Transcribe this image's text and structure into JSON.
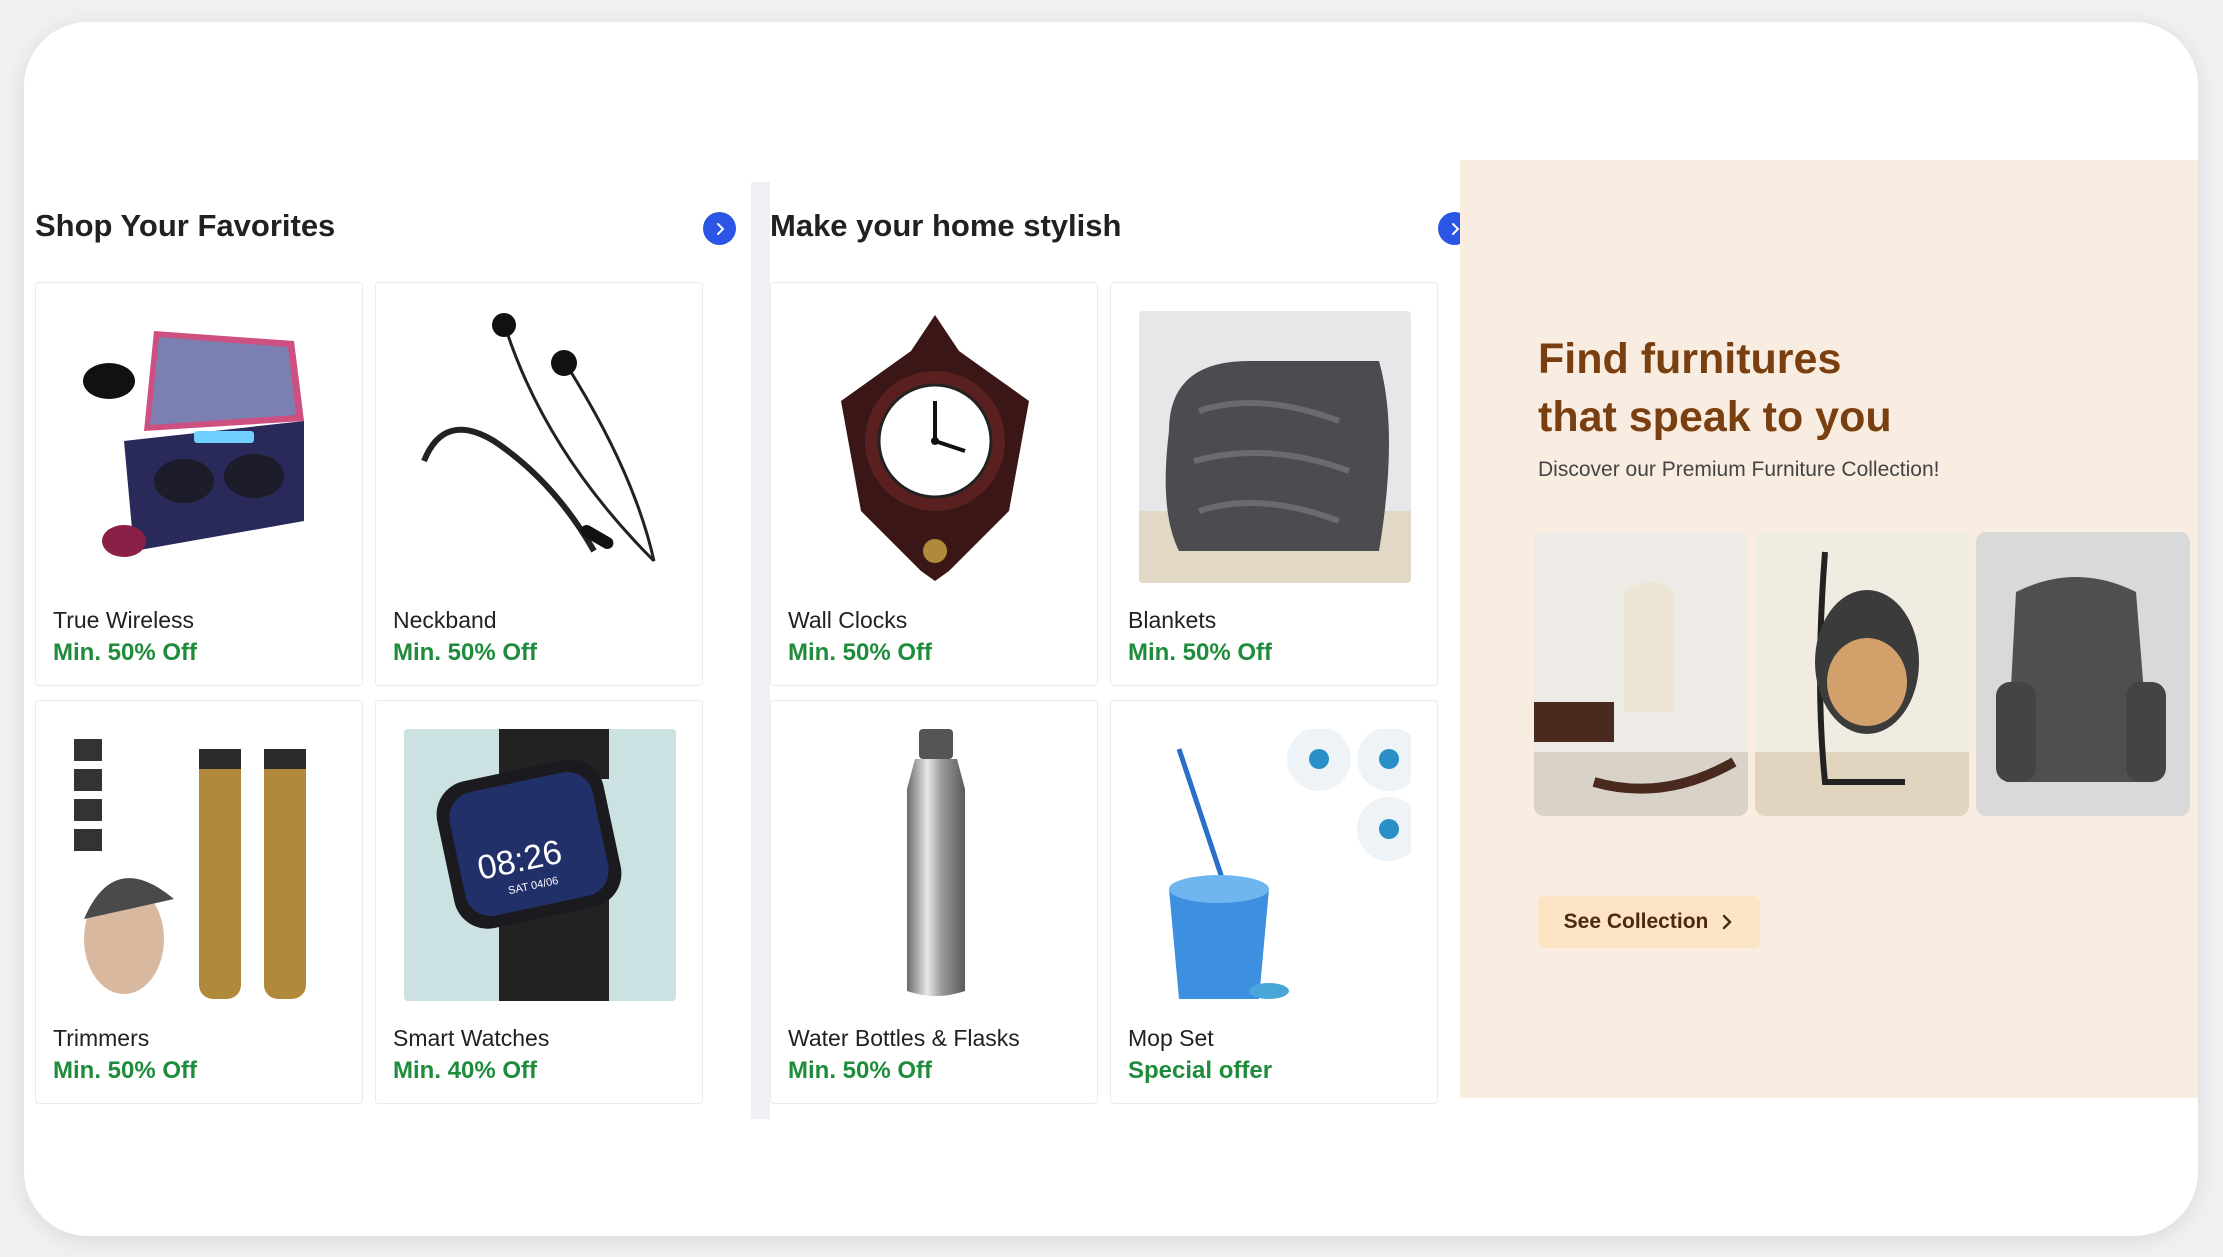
{
  "sections": [
    {
      "title": "Shop Your Favorites",
      "items": [
        {
          "label": "True Wireless",
          "offer": "Min. 50% Off"
        },
        {
          "label": "Neckband",
          "offer": "Min. 50% Off"
        },
        {
          "label": "Trimmers",
          "offer": "Min. 50% Off"
        },
        {
          "label": "Smart Watches",
          "offer": "Min. 40% Off"
        }
      ]
    },
    {
      "title": "Make your home stylish",
      "items": [
        {
          "label": "Wall Clocks",
          "offer": "Min. 50% Off"
        },
        {
          "label": "Blankets",
          "offer": "Min. 50% Off"
        },
        {
          "label": "Water Bottles & Flasks",
          "offer": "Min. 50% Off"
        },
        {
          "label": "Mop Set",
          "offer": "Special offer"
        }
      ]
    }
  ],
  "banner": {
    "title_line1": "Find furnitures",
    "title_line2": "that speak to you",
    "subtitle": "Discover our Premium Furniture Collection!",
    "button_label": "See Collection"
  },
  "watch_time": "08:26",
  "watch_date": "SAT 04/06",
  "colors": {
    "offer_green": "#1e8c3a",
    "arrow_blue": "#2a55e5",
    "banner_bg": "#f8ede0",
    "banner_title": "#7a3f10",
    "button_bg": "#fde4c4"
  },
  "icons": [
    "chevron-right-icon"
  ]
}
